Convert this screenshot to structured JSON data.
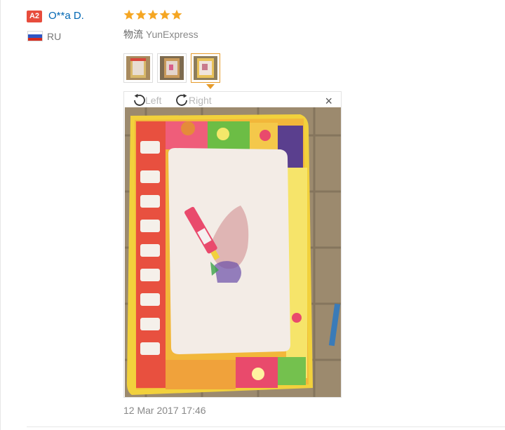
{
  "reviewer": {
    "level_badge": "A2",
    "name": "O**a D.",
    "country_code": "RU",
    "flag_colors": [
      "#ffffff",
      "#2e56c4",
      "#d52b1e"
    ]
  },
  "review": {
    "rating": 5,
    "max_rating": 5,
    "star_color": "#f5a623",
    "shipping_label": "物流",
    "shipping_method": "YunExpress",
    "date": "12 Mar 2017 17:46"
  },
  "viewer": {
    "rotate_left_label": "Left",
    "rotate_right_label": "Right",
    "close_symbol": "×",
    "selected_thumbnail": 3,
    "thumbnail_count": 3
  },
  "icons": {
    "rotate_left": "rotate-left-icon",
    "rotate_right": "rotate-right-icon",
    "close": "close-icon",
    "star": "star-icon"
  }
}
